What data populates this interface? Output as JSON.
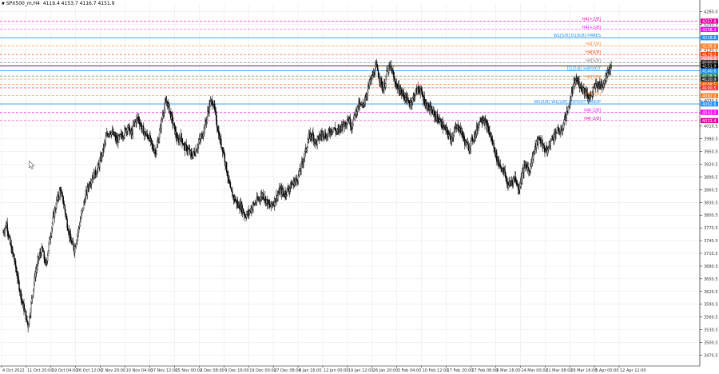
{
  "header": {
    "symbol": "SPX500_m,H4",
    "ohlc": "4119.4 4153.7 4116.7 4151.9"
  },
  "colors": {
    "background": "#ffffff",
    "grid": "#e6e6e6",
    "candle": "#000000",
    "axis_text": "#333333"
  },
  "chart_data": {
    "type": "candlestick",
    "title": "",
    "xlabel": "",
    "ylabel": "",
    "ylim": [
      3445,
      4300
    ],
    "y_ticks": [
      4280.0,
      4250.5,
      4220.5,
      4190.0,
      4160.0,
      4130.5,
      4100.5,
      4070.5,
      4040.5,
      4010.5,
      3980.5,
      3950.5,
      3920.5,
      3890.5,
      3860.5,
      3830.5,
      3800.5,
      3770.5,
      3740.5,
      3710.5,
      3680.5,
      3650.5,
      3620.5,
      3590.5,
      3560.5,
      3530.5,
      3500.5,
      3470.5
    ],
    "y_tick_labels": [
      "4280.0",
      "4250.5",
      "4220.5",
      "4190.0",
      "4160.0",
      "4130.5",
      "4100.5",
      "4070.5",
      "4040.5",
      "4010.5",
      "3980.5",
      "3950.5",
      "3920.5",
      "3890.5",
      "3860.5",
      "3830.5",
      "3800.5",
      "3770.5",
      "3740.5",
      "3710.5",
      "3680.5",
      "3650.5",
      "3620.5",
      "3590.5",
      "3560.5",
      "3530.5",
      "3500.5",
      "3470.5"
    ],
    "x_ticks": [
      "4 Oct 2022",
      "11 Oct 20:00",
      "19 Oct 04:00",
      "26 Oct 12:00",
      "2 Nov 20:00",
      "10 Nov 04:00",
      "17 Nov 12:00",
      "25 Nov 00:00",
      "2 Dec 08:00",
      "9 Dec 16:00",
      "19 Dec 00:00",
      "27 Dec 08:00",
      "4 Jan 16:00",
      "12 Jan 00:00",
      "19 Jan 12:00",
      "26 Jan 20:00",
      "3 Feb 04:00",
      "10 Feb 12:00",
      "17 Feb 20:00",
      "27 Feb 08:00",
      "6 Mar 16:00",
      "14 Mar 00:00",
      "21 Mar 08:00",
      "28 Mar 16:00",
      "5 Apr 00:00",
      "12 Apr 12:00"
    ],
    "x_range": [
      "4 Oct 2022",
      "12 Apr 12:00"
    ],
    "closes_approx": [
      3760,
      3780,
      3730,
      3700,
      3655,
      3610,
      3575,
      3540,
      3600,
      3660,
      3700,
      3720,
      3680,
      3740,
      3790,
      3830,
      3860,
      3830,
      3780,
      3740,
      3720,
      3760,
      3800,
      3840,
      3870,
      3890,
      3900,
      3920,
      3950,
      3985,
      4000,
      3990,
      3975,
      3985,
      3995,
      4010,
      3990,
      4020,
      4030,
      4005,
      3990,
      3985,
      3960,
      3950,
      3995,
      4045,
      4070,
      4040,
      4010,
      3975,
      3985,
      3960,
      3955,
      3940,
      3950,
      3970,
      3990,
      4020,
      4060,
      4070,
      4020,
      3975,
      3950,
      3900,
      3855,
      3840,
      3825,
      3820,
      3800,
      3805,
      3820,
      3830,
      3840,
      3850,
      3835,
      3820,
      3830,
      3845,
      3860,
      3850,
      3860,
      3870,
      3880,
      3890,
      3920,
      3950,
      3985,
      3990,
      3970,
      3985,
      3995,
      3985,
      4000,
      4005,
      3995,
      4010,
      4015,
      4030,
      4010,
      4040,
      4060,
      4055,
      4080,
      4110,
      4130,
      4150,
      4120,
      4095,
      4140,
      4150,
      4120,
      4100,
      4090,
      4080,
      4065,
      4070,
      4090,
      4100,
      4080,
      4060,
      4050,
      4040,
      4030,
      4020,
      4005,
      3995,
      3980,
      4000,
      4010,
      3995,
      3970,
      3960,
      3980,
      3995,
      4025,
      4030,
      4010,
      3990,
      3960,
      3930,
      3915,
      3900,
      3870,
      3880,
      3890,
      3860,
      3900,
      3920,
      3905,
      3940,
      3970,
      3980,
      3960,
      3950,
      3975,
      3990,
      4000,
      3995,
      4030,
      4050,
      4090,
      4120,
      4110,
      4100,
      4090,
      4075,
      4095,
      4110,
      4105,
      4115,
      4140,
      4152
    ],
    "price_levels": [
      {
        "label": "H4[+2/8]",
        "value": 4257.8,
        "color": "#e600a3",
        "style": "dashed"
      },
      {
        "label": "H4[+1/8]",
        "value": 4238.3,
        "color": "#ff00ff",
        "style": "dashed"
      },
      {
        "label": "W1[5/8] D1[6/8] H4RES",
        "value": 4218.6,
        "color": "#1e90ff",
        "style": "solid"
      },
      {
        "label": "H4[7/8]",
        "value": 4198.9,
        "color": "#ff7f27",
        "style": "dashed"
      },
      {
        "label": "H4[6/8]",
        "value": 4179.2,
        "color": "#ff4500",
        "style": "dashed"
      },
      {
        "label": "",
        "value": 4169.8,
        "color": "#ff8c8c",
        "style": "dashed"
      },
      {
        "label": "H4[5/8]",
        "value": 4159.6,
        "color": "#808080",
        "style": "dashed"
      },
      {
        "label": "",
        "value": 4151.9,
        "color": "#000000",
        "style": "solid"
      },
      {
        "label": "D1[5/8] H4PIVOT",
        "value": 4140.6,
        "color": "#1e90ff",
        "style": "solid"
      },
      {
        "label": "",
        "value": 4128.3,
        "color": "#2e8b57",
        "style": "dashed"
      },
      {
        "label": "H4[3/8]",
        "value": 4120.9,
        "color": "#ff7f27",
        "style": "dashed"
      },
      {
        "label": "",
        "value": 4108.5,
        "color": "#ff6600",
        "style": "dashed"
      },
      {
        "label": "",
        "value": 4100.5,
        "color": "#ff3333",
        "style": "dashed"
      },
      {
        "label": "H4[1/8]",
        "value": 4082.0,
        "color": "#ff7f27",
        "style": "dashed"
      },
      {
        "label": "W1[3/8] W1[2/8] D1PIVOT H4SUP",
        "value": 4062.6,
        "color": "#1e90ff",
        "style": "solid"
      },
      {
        "label": "H4[-1/8]",
        "value": 4043.0,
        "color": "#ff00ff",
        "style": "dashed"
      },
      {
        "label": "H4[-2/8]",
        "value": 4023.4,
        "color": "#e600a3",
        "style": "dashed"
      }
    ],
    "price_tags": [
      {
        "text": "4257.8",
        "value": 4257.8,
        "color": "#e600a3"
      },
      {
        "text": "4238.3",
        "value": 4238.3,
        "color": "#ff00ff"
      },
      {
        "text": "4218.6",
        "value": 4218.6,
        "color": "#1e90ff"
      },
      {
        "text": "4198.9",
        "value": 4198.9,
        "color": "#ff7f27"
      },
      {
        "text": "4179.2",
        "value": 4179.2,
        "color": "#ff4500"
      },
      {
        "text": "4169.8",
        "value": 4169.8,
        "color": "#ff8c8c"
      },
      {
        "text": "4160.0",
        "value": 4160.0,
        "color": "#2e2e2e"
      },
      {
        "text": "4151.9",
        "value": 4151.9,
        "color": "#000000"
      },
      {
        "text": "4140.6",
        "value": 4140.6,
        "color": "#1e90ff"
      },
      {
        "text": "4128.3",
        "value": 4128.3,
        "color": "#2e8b57"
      },
      {
        "text": "4120.9",
        "value": 4120.9,
        "color": "#2e2e2e"
      },
      {
        "text": "4108.5",
        "value": 4108.5,
        "color": "#ff6600"
      },
      {
        "text": "4100.5",
        "value": 4100.5,
        "color": "#ff3333"
      },
      {
        "text": "4082.0",
        "value": 4082.0,
        "color": "#ff7f27"
      },
      {
        "text": "4062.6",
        "value": 4062.6,
        "color": "#1e90ff"
      },
      {
        "text": "4043.0",
        "value": 4043.0,
        "color": "#ff00ff"
      },
      {
        "text": "4023.4",
        "value": 4023.4,
        "color": "#e600a3"
      }
    ]
  }
}
